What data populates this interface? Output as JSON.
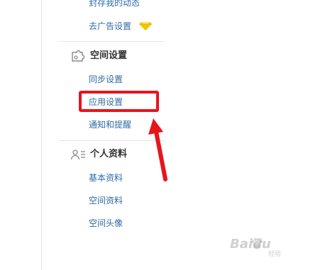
{
  "menu": {
    "top_partial_item": "封存我的动态",
    "ad_settings": "去广告设置",
    "space_section": {
      "title": "空间设置",
      "icon": "puzzle-icon",
      "items": [
        "同步设置",
        "应用设置",
        "通知和提醒"
      ]
    },
    "profile_section": {
      "title": "个人资料",
      "icon": "person-card-icon",
      "items": [
        "基本资料",
        "空间资料",
        "空间头像"
      ]
    }
  },
  "annotation": {
    "highlight_color": "#e8141b",
    "highlighted_item": "应用设置"
  },
  "watermark": {
    "text": "Baidu",
    "sub": "经验"
  },
  "colors": {
    "link": "#2f6aa8",
    "section_title": "#333333",
    "gem": "#f5c400"
  }
}
